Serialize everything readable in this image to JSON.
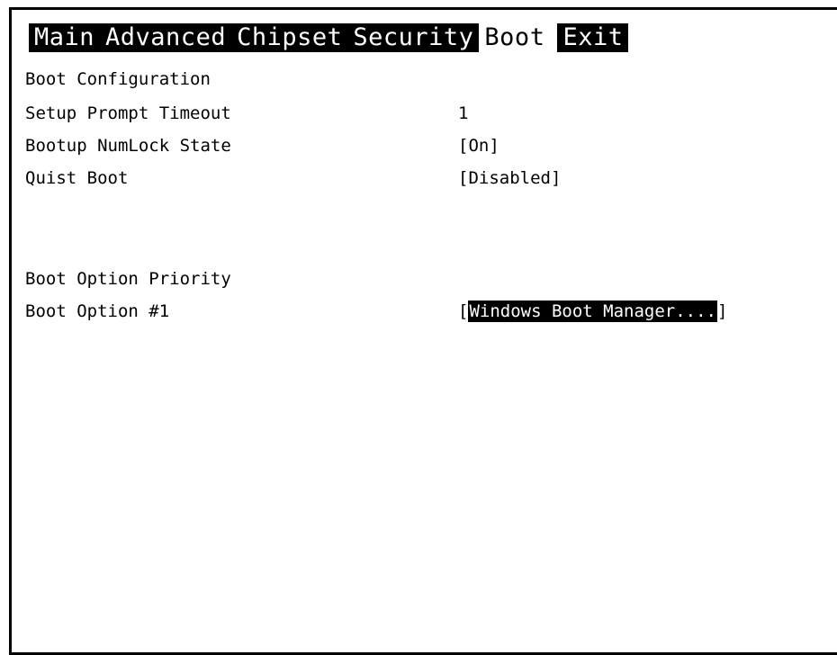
{
  "tabs": [
    {
      "label": "Main"
    },
    {
      "label": "Advanced"
    },
    {
      "label": "Chipset"
    },
    {
      "label": "Security"
    },
    {
      "label": "Boot",
      "active": true
    },
    {
      "label": "Exit"
    }
  ],
  "boot": {
    "section_title": "Boot Configuration",
    "setup_prompt_timeout": {
      "label": "Setup Prompt Timeout",
      "value": "1"
    },
    "numlock_state": {
      "label": "Bootup NumLock State",
      "value": "[On]"
    },
    "quiet_boot": {
      "label": "Quist Boot",
      "value": "[Disabled]"
    },
    "priority_title": "Boot Option Priority",
    "boot_option_1": {
      "label": "Boot Option #1",
      "bracket_open": "[",
      "value": "Windows Boot Manager....",
      "bracket_close": "]"
    }
  },
  "colors": {
    "background": "#ffffff",
    "foreground": "#000000",
    "highlight_bg": "#000000",
    "highlight_fg": "#ffffff"
  }
}
